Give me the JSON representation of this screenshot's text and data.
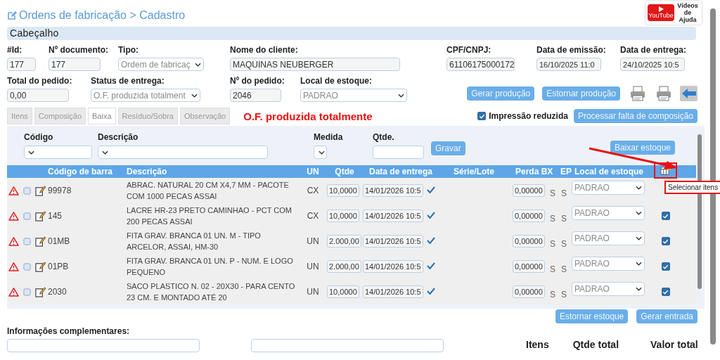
{
  "title": "Ordens de fabricação > Cadastro",
  "help_badge": {
    "brand": "YouTube",
    "text": "Videos de Ajuda"
  },
  "section_title": "Cabeçalho",
  "header_rows": [
    [
      {
        "label": "#Id:",
        "value": "177",
        "kind": "input",
        "disabled": false
      },
      {
        "label": "Nº documento:",
        "value": "177",
        "kind": "input",
        "disabled": false
      },
      {
        "label": "Tipo:",
        "value": "Ordem de fabricaç",
        "kind": "select",
        "disabled": true
      },
      {
        "label": "Nome do cliente:",
        "value": "MAQUINAS NEUBERGER",
        "kind": "input",
        "disabled": false
      },
      {
        "label": "CPF/CNPJ:",
        "value": "61106175000172",
        "kind": "input",
        "disabled": false
      },
      {
        "label": "Data de emissão:",
        "value": "16/10/2025 11:0",
        "kind": "input",
        "disabled": false
      },
      {
        "label": "Data de entrega:",
        "value": "24/10/2025 10:5",
        "kind": "input",
        "disabled": false
      }
    ],
    [
      {
        "label": "Total do pedido:",
        "value": "0,00",
        "kind": "input",
        "disabled": false
      },
      {
        "label": "Status de entrega:",
        "value": "O.F. produzida totalment",
        "kind": "select",
        "disabled": true
      },
      {
        "label": "Nº do pedido:",
        "value": "2046",
        "kind": "input",
        "disabled": false
      },
      {
        "label": "Local de estoque:",
        "value": "PADRAO",
        "kind": "select",
        "disabled": true
      }
    ]
  ],
  "actions": [
    "Gerar produção",
    "Estornar produção"
  ],
  "tabs": [
    {
      "label": "Itens",
      "selected": false
    },
    {
      "label": "Composição",
      "selected": false
    },
    {
      "label": "Baixa",
      "selected": true
    },
    {
      "label": "Resíduo/Sobra",
      "selected": false
    },
    {
      "label": "Observação",
      "selected": false
    }
  ],
  "status_message": "O.F. produzida totalmente",
  "reduced_print": {
    "label": "Impressão reduzida",
    "checked": true
  },
  "process_button": "Processar falta de composição",
  "filters": [
    {
      "label": "Código",
      "kind": "select"
    },
    {
      "label": "Descrição",
      "kind": "select"
    },
    {
      "label": "Medida",
      "kind": "select"
    },
    {
      "label": "Qtde.",
      "kind": "input"
    }
  ],
  "save_button": "Gravar",
  "stock_button": "Baixar estoque",
  "table": {
    "columns": [
      "Código de barra",
      "Descrição",
      "UN",
      "Qtde",
      "Data de entrega",
      "Série/Lote",
      "Perda BX",
      "EP",
      "Local de estoque"
    ],
    "rows": [
      {
        "code": "99978",
        "description": "ABRAC. NATURAL 20 CM X4,7 MM - PACOTE COM 1000 PECAS ASSAI",
        "un": "CX",
        "qty": "10,0000",
        "date": "14/01/2026 10:5",
        "loss": "0,00000",
        "bx": "S",
        "ep": "S",
        "stock": "PADRAO"
      },
      {
        "code": "145",
        "description": "LACRE HR-23 PRETO CAMINHAO - PCT COM 200 PECAS ASSAI",
        "un": "CX",
        "qty": "10,0000",
        "date": "14/01/2026 10:5",
        "loss": "0,00000",
        "bx": "S",
        "ep": "S",
        "stock": "PADRAO",
        "checked": true
      },
      {
        "code": "01MB",
        "description": "FITA GRAV. BRANCA 01 UN. M - TIPO ARCELOR, ASSAI, HM-30",
        "un": "UN",
        "qty": "2.000,00",
        "date": "14/01/2026 10:5",
        "loss": "0,00000",
        "bx": "S",
        "ep": "S",
        "stock": "PADRAO",
        "checked": true
      },
      {
        "code": "01PB",
        "description": "FITA GRAV. BRANCA 01 UN. P - NUM. E LOGO PEQUENO",
        "un": "UN",
        "qty": "2.000,00",
        "date": "14/01/2026 10:5",
        "loss": "0,00000",
        "bx": "S",
        "ep": "S",
        "stock": "PADRAO",
        "checked": true
      },
      {
        "code": "2030",
        "description": "SACO PLASTICO N. 02 - 20X30 - PARA CENTO 23 CM. E MONTADO ATÉ 20",
        "un": "UN",
        "qty": "10,0000",
        "date": "14/01/2026 10:5",
        "loss": "0,00000",
        "bx": "S",
        "ep": "S",
        "stock": "PADRAO",
        "checked": true
      }
    ]
  },
  "tooltip": "Selecionar itens",
  "bottom_buttons": [
    "Estornar estoque",
    "Gerar entrada"
  ],
  "notes_label": "Informações complementares:",
  "totals_labels": [
    "Itens",
    "Qtde total",
    "Valor total"
  ]
}
